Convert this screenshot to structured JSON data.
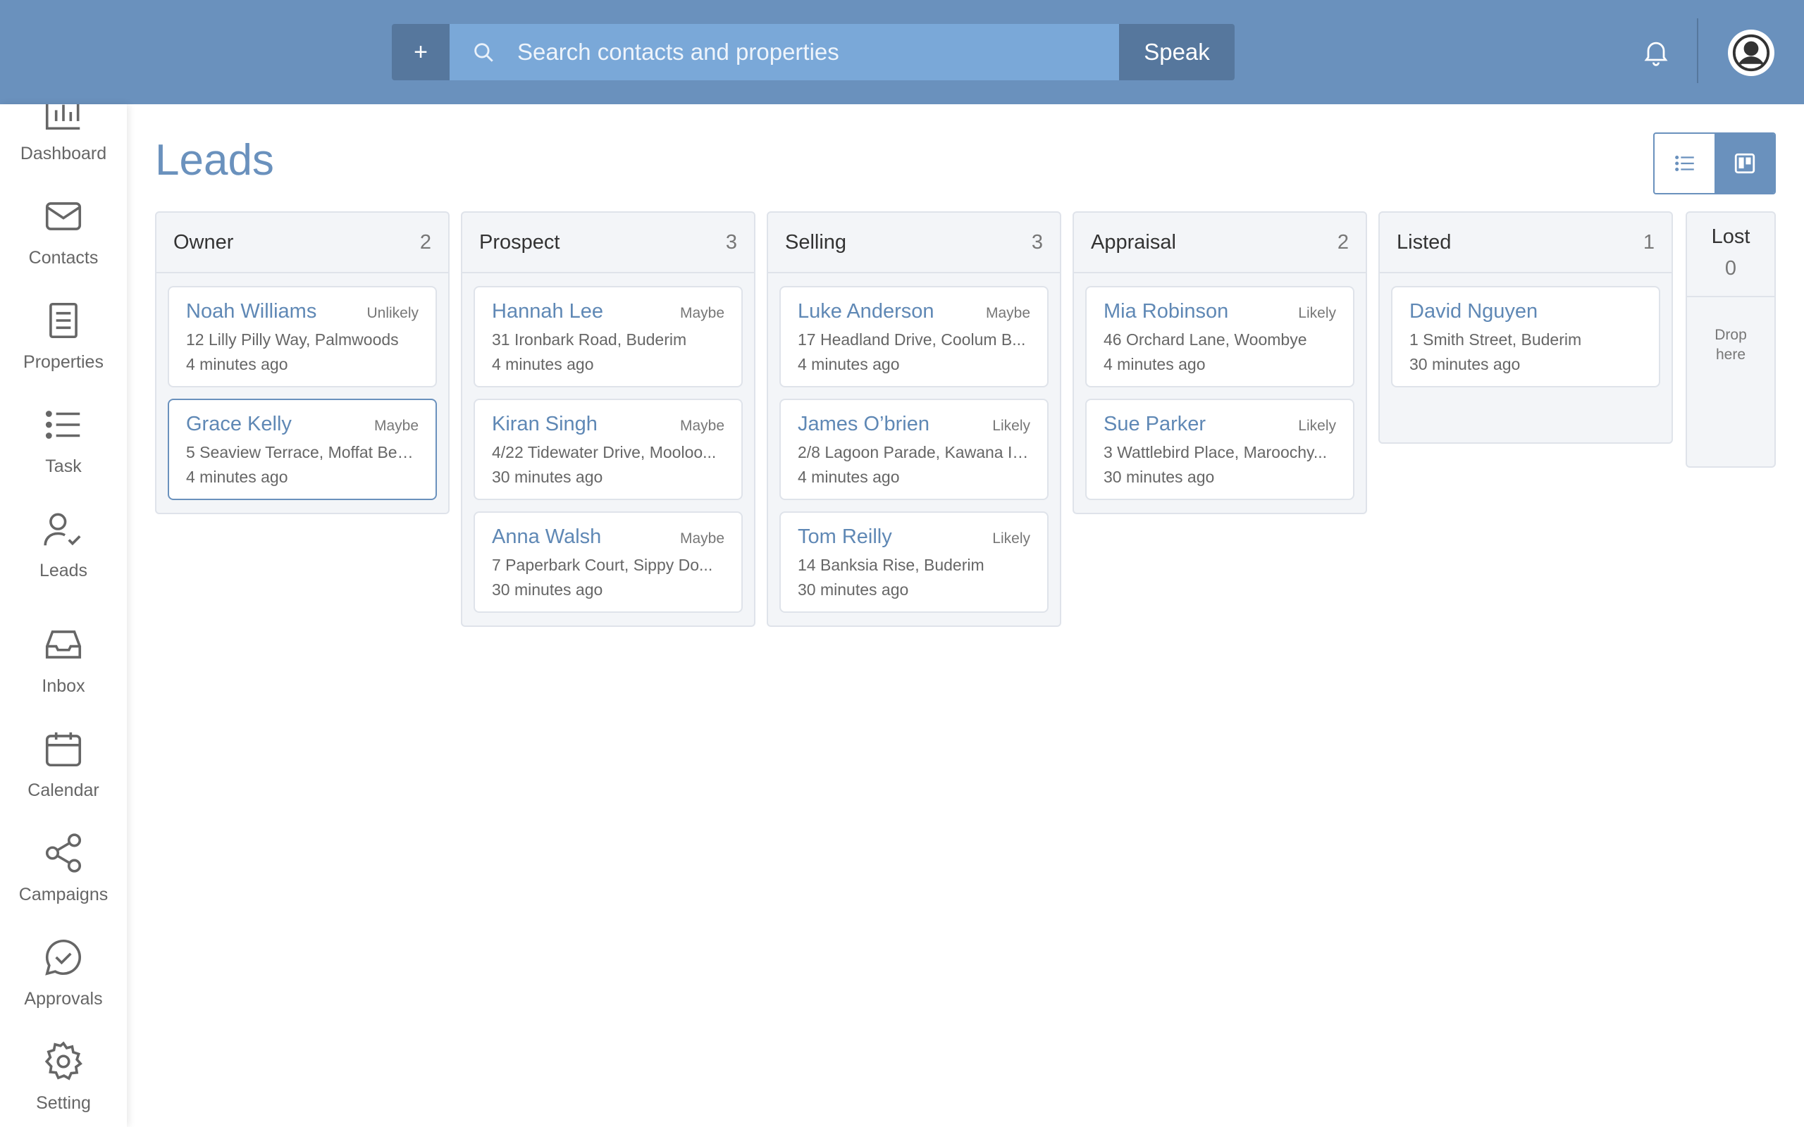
{
  "topbar": {
    "plus_label": "+",
    "search_placeholder": "Search contacts and properties",
    "speak_label": "Speak",
    "icons": {
      "plus": "plus-icon",
      "search": "search-icon",
      "bell": "bell-icon",
      "avatar": "user-avatar-icon"
    },
    "color": "#6a91bd"
  },
  "sidebar": {
    "items": [
      {
        "label": "Dashboard",
        "icon": "bar-chart-icon"
      },
      {
        "label": "Contacts",
        "icon": "envelope-icon"
      },
      {
        "label": "Properties",
        "icon": "document-icon"
      },
      {
        "label": "Task",
        "icon": "list-icon"
      },
      {
        "label": "Leads",
        "icon": "user-check-icon"
      },
      {
        "label": "Inbox",
        "icon": "inbox-icon"
      },
      {
        "label": "Calendar",
        "icon": "calendar-icon"
      },
      {
        "label": "Campaigns",
        "icon": "share-icon"
      },
      {
        "label": "Approvals",
        "icon": "chat-check-icon"
      },
      {
        "label": "Setting",
        "icon": "gear-icon"
      }
    ]
  },
  "page": {
    "title": "Leads",
    "view_toggle": {
      "list_icon": "list-view-icon",
      "board_icon": "kanban-view-icon",
      "active": "board"
    }
  },
  "board": {
    "columns": [
      {
        "title": "Owner",
        "count": "2",
        "cards": [
          {
            "name": "Noah Williams",
            "tag": "Unlikely",
            "address": "12 Lilly Pilly Way, Palmwoods",
            "time": "4 minutes ago"
          },
          {
            "name": "Grace Kelly",
            "tag": "Maybe",
            "address": "5 Seaview Terrace, Moffat Bea...",
            "time": "4 minutes ago",
            "selected": true
          }
        ]
      },
      {
        "title": "Prospect",
        "count": "3",
        "cards": [
          {
            "name": "Hannah Lee",
            "tag": "Maybe",
            "address": "31 Ironbark Road, Buderim",
            "time": "4 minutes ago"
          },
          {
            "name": "Kiran Singh",
            "tag": "Maybe",
            "address": "4/22 Tidewater Drive, Mooloo...",
            "time": "30 minutes ago"
          },
          {
            "name": "Anna Walsh",
            "tag": "Maybe",
            "address": "7 Paperbark Court, Sippy Do...",
            "time": "30 minutes ago"
          }
        ]
      },
      {
        "title": "Selling",
        "count": "3",
        "cards": [
          {
            "name": "Luke Anderson",
            "tag": "Maybe",
            "address": "17 Headland Drive, Coolum B...",
            "time": "4 minutes ago"
          },
          {
            "name": "James O’brien",
            "tag": "Likely",
            "address": "2/8 Lagoon Parade, Kawana Is...",
            "time": "4 minutes ago"
          },
          {
            "name": "Tom Reilly",
            "tag": "Likely",
            "address": "14 Banksia Rise, Buderim",
            "time": "30 minutes ago"
          }
        ]
      },
      {
        "title": "Appraisal",
        "count": "2",
        "cards": [
          {
            "name": "Mia Robinson",
            "tag": "Likely",
            "address": "46 Orchard Lane, Woombye",
            "time": "4 minutes ago"
          },
          {
            "name": "Sue Parker",
            "tag": "Likely",
            "address": "3 Wattlebird Place, Maroochy...",
            "time": "30 minutes ago"
          }
        ]
      },
      {
        "title": "Listed",
        "count": "1",
        "cards": [
          {
            "name": "David Nguyen",
            "tag": "",
            "address": "1 Smith Street, Buderim",
            "time": "30 minutes ago"
          }
        ]
      }
    ],
    "lost": {
      "title": "Lost",
      "count": "0",
      "drop_text": "Drop here"
    }
  }
}
